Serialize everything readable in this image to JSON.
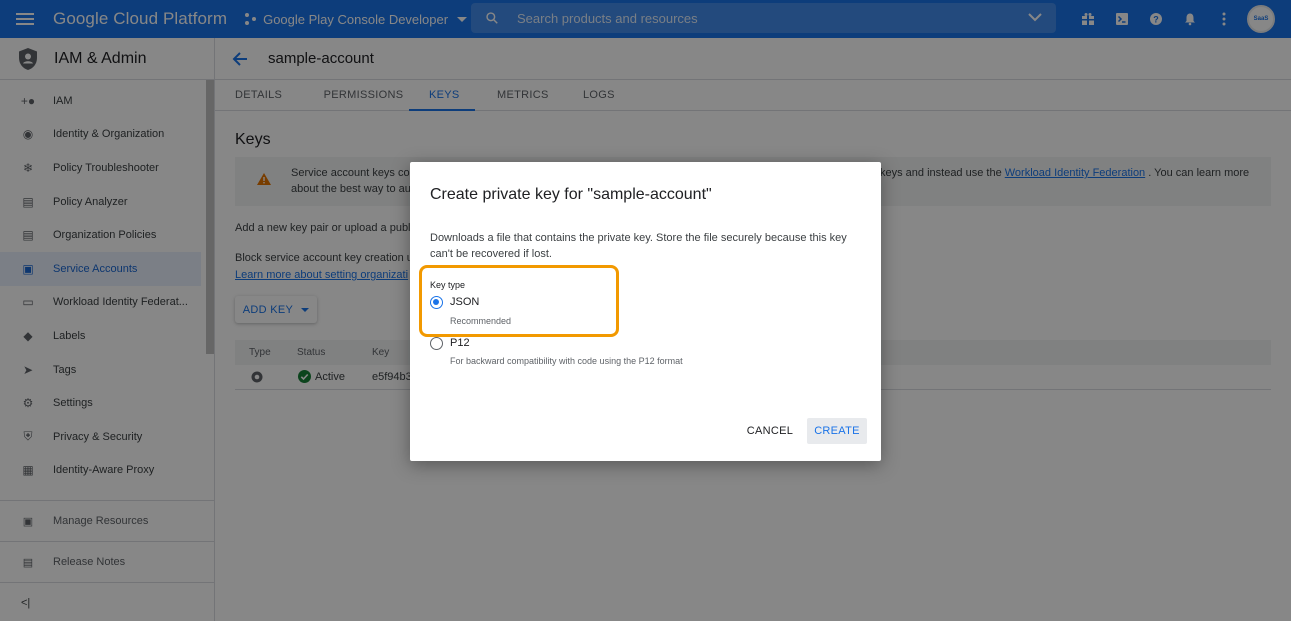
{
  "topbar": {
    "brand": "Google Cloud Platform",
    "project": "Google Play Console Developer",
    "search_placeholder": "Search products and resources",
    "avatar_text": "SaaS",
    "colors": {
      "bar": "#1a73e8"
    }
  },
  "sidebar": {
    "title": "IAM & Admin",
    "items": [
      {
        "label": "IAM",
        "icon": "person-add-icon"
      },
      {
        "label": "Identity & Organization",
        "icon": "account-circle-icon"
      },
      {
        "label": "Policy Troubleshooter",
        "icon": "wrench-icon"
      },
      {
        "label": "Policy Analyzer",
        "icon": "document-search-icon"
      },
      {
        "label": "Organization Policies",
        "icon": "list-box-icon"
      },
      {
        "label": "Service Accounts",
        "icon": "service-account-icon",
        "active": true
      },
      {
        "label": "Workload Identity Federat...",
        "icon": "id-card-icon"
      },
      {
        "label": "Labels",
        "icon": "tag-icon"
      },
      {
        "label": "Tags",
        "icon": "chevron-tag-icon"
      },
      {
        "label": "Settings",
        "icon": "gear-icon"
      },
      {
        "label": "Privacy & Security",
        "icon": "shield-icon"
      },
      {
        "label": "Identity-Aware Proxy",
        "icon": "proxy-icon"
      }
    ],
    "manage_resources": "Manage Resources",
    "release_notes": "Release Notes",
    "collapse_glyph": "<|"
  },
  "main": {
    "account": "sample-account",
    "tabs": [
      "DETAILS",
      "PERMISSIONS",
      "KEYS",
      "METRICS",
      "LOGS"
    ],
    "active_tab": "KEYS",
    "section_title": "Keys",
    "warning": {
      "text1": "Service account keys co",
      "text2": "about the best way to au",
      "right_text_a": "keys and instead use the ",
      "right_link": "Workload Identity Federation",
      "right_text_b": " . You can learn more"
    },
    "add_line": "Add a new key pair or upload a publi",
    "block_line": "Block service account key creation u",
    "learn_link": "Learn more about setting organizati",
    "add_key_label": "ADD KEY",
    "table": {
      "headers": [
        "Type",
        "Status",
        "Key"
      ],
      "rows": [
        {
          "status": "Active",
          "key": "e5f94b3"
        }
      ]
    }
  },
  "dialog": {
    "title": "Create private key for \"sample-account\"",
    "description": "Downloads a file that contains the private key. Store the file securely because this key can't be recovered if lost.",
    "key_type_label": "Key type",
    "options": [
      {
        "label": "JSON",
        "sub": "Recommended",
        "selected": true
      },
      {
        "label": "P12",
        "sub": "For backward compatibility with code using the P12 format",
        "selected": false
      }
    ],
    "cancel_label": "CANCEL",
    "create_label": "CREATE",
    "highlight_color": "#f29900"
  }
}
